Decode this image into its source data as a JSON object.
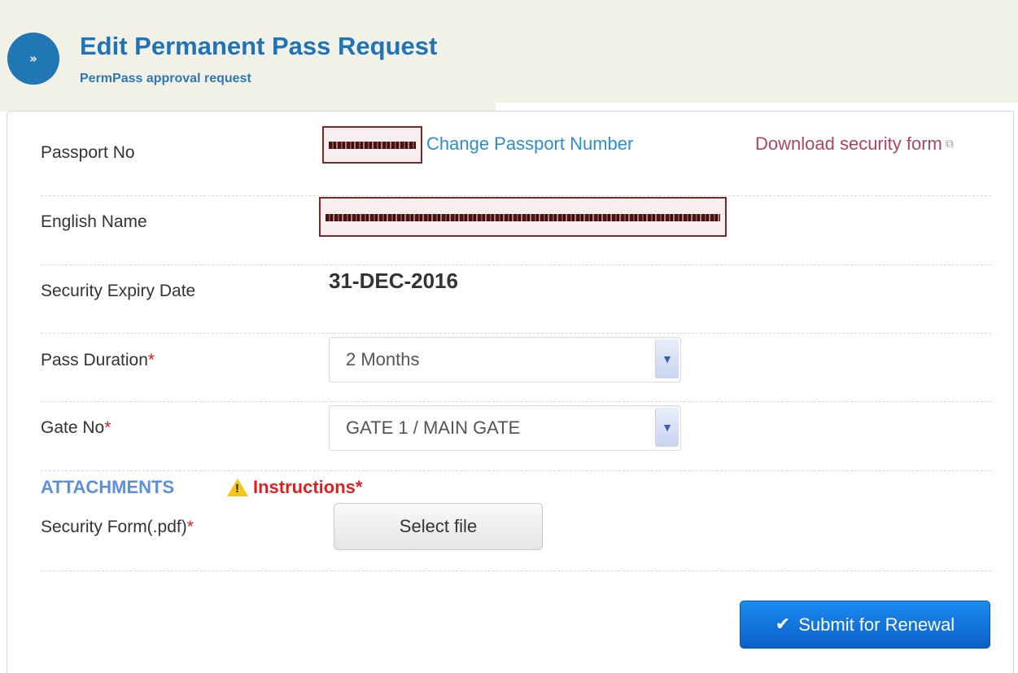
{
  "header": {
    "nav_icon": "double-chevron-right-icon",
    "nav_glyph": "»",
    "title": "Edit Permanent Pass Request",
    "subtitle": "PermPass approval request"
  },
  "form": {
    "passport": {
      "label": "Passport No",
      "change_link": "Change Passport Number",
      "download_link": "Download security form"
    },
    "english_name": {
      "label": "English Name"
    },
    "security_expiry": {
      "label": "Security Expiry Date",
      "value": "31-DEC-2016"
    },
    "pass_duration": {
      "label": "Pass Duration",
      "required_mark": "*",
      "selected": "2 Months"
    },
    "gate_no": {
      "label": "Gate No",
      "required_mark": "*",
      "selected": "GATE 1 / MAIN GATE"
    },
    "attachments": {
      "heading": "ATTACHMENTS",
      "instructions_label": "Instructions",
      "instructions_required": "*",
      "security_form_label": "Security Form(.pdf)",
      "security_form_required": "*",
      "select_file_label": "Select file"
    },
    "submit_label": "Submit for Renewal"
  },
  "colors": {
    "title_blue": "#2073b6",
    "link_blue": "#2a8fd0",
    "download_link": "#b04466",
    "required": "#d42020",
    "submit_bg": "#0a6ad6"
  }
}
